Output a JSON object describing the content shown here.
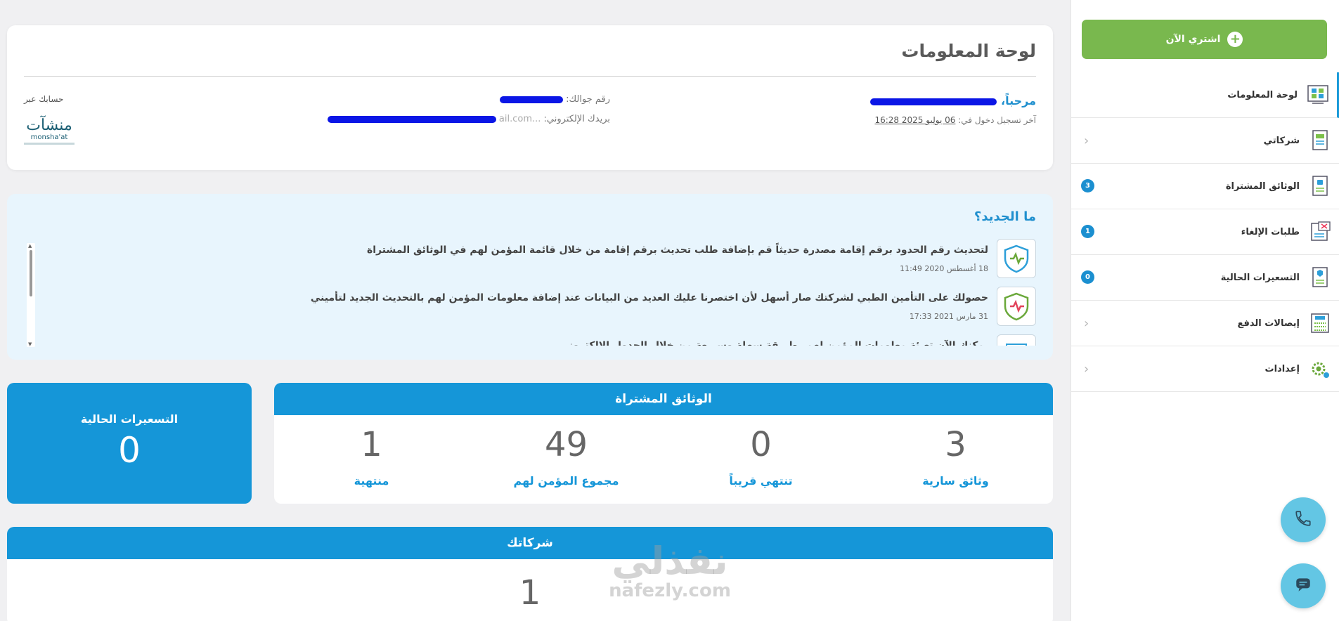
{
  "sidebar": {
    "buy_button": "اشتري الآن",
    "items": [
      {
        "label": "لوحة المعلومات",
        "icon": "dashboard-icon",
        "active": true
      },
      {
        "label": "شركاتي",
        "icon": "companies-document-icon",
        "chevron": true
      },
      {
        "label": "الوثائق المشتراة",
        "icon": "purchased-documents-icon",
        "badge": "3"
      },
      {
        "label": "طلبات الإلغاء",
        "icon": "cancellation-requests-icon",
        "badge": "1"
      },
      {
        "label": "التسعيرات الحالية",
        "icon": "current-pricing-icon",
        "badge": "0"
      },
      {
        "label": "إيصالات الدفع",
        "icon": "payment-receipts-icon",
        "chevron": true
      },
      {
        "label": "إعدادات",
        "icon": "settings-gear-icon",
        "chevron": true
      }
    ]
  },
  "dashboard": {
    "title": "لوحة المعلومات",
    "welcome": "مرحباً،",
    "last_login_label": "آخر تسجيل دخول في:",
    "last_login_date": "06 يوليو 2025",
    "last_login_time": "16:28",
    "phone_label": "رقم جوالك:",
    "email_label": "بريدك الإلكتروني:",
    "email_tail": "...ail.com",
    "account_via": "حسابك عبر",
    "partner_logo_ar": "منشآت",
    "partner_logo_en": "monsha'at"
  },
  "news": {
    "title": "ما الجديد؟",
    "items": [
      {
        "text": "لتحديث رقم الحدود برقم إقامة مصدرة حديثاً قم بإضافة طلب تحديث برقم إقامة من خلال قائمة المؤمن لهم في الوثائق المشتراة",
        "date": "18 أغسطس 2020 11:49",
        "icon": "health-shield-icon"
      },
      {
        "text": "حصولك على التأمين الطبي لشركتك صار أسهل لأن اختصرنا عليك العديد من البيانات عند إضافة معلومات المؤمن لهم بالتحديث الجديد لتأميني",
        "date": "31 مارس 2021 17:33",
        "icon": "health-shield-icon"
      },
      {
        "text": "يمكنك الآن تعبئة معلومات المؤمن لهم بطريقة سهلة وسريعة من خلال الجدول الإلكتروني...",
        "date": "",
        "icon": "spreadsheet-icon"
      }
    ]
  },
  "pricing": {
    "title": "التسعيرات الحالية",
    "value": "0"
  },
  "purchased_documents": {
    "title": "الوثائق المشتراة",
    "stats": [
      {
        "value": "3",
        "label": "وثائق سارية"
      },
      {
        "value": "0",
        "label": "تنتهي قريباً"
      },
      {
        "value": "49",
        "label": "مجموع المؤمن لهم"
      },
      {
        "value": "1",
        "label": "منتهية"
      }
    ]
  },
  "companies": {
    "title": "شركاتك",
    "value": "1"
  },
  "watermark": {
    "ar": "نفذلي",
    "en": "nafezly.com"
  },
  "colors": {
    "primary": "#1596d8",
    "green": "#79b84e",
    "news_bg": "#e8f5fd",
    "fab": "#63c6e4",
    "redaction": "#0b16e6"
  }
}
